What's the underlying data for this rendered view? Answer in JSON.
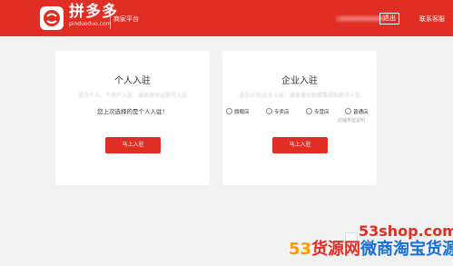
{
  "header": {
    "brand": "拼多多",
    "brand_sub": "pinduoduo.com",
    "platform": "商家平台",
    "phone": "188888888888",
    "logout": "退出",
    "contact": "联系客服"
  },
  "personal": {
    "title": "个人入驻",
    "desc": "适合个人、个体户入驻，接收身份证即可入驻",
    "note": "您上次选择的是个人入驻！",
    "button": "马上入驻"
  },
  "enterprise": {
    "title": "企业入驻",
    "desc": "适合公司/企业入驻，接收营业执照等资料即可入驻",
    "store_types": [
      "旗舰店",
      "专卖店",
      "专营店",
      "普通店"
    ],
    "store_requirements": "店铺类型说明",
    "button": "马上入驻"
  },
  "watermark": {
    "site": "53shop.com",
    "part1": "53",
    "part2": "货源网",
    "part3": "微商淘宝货源"
  }
}
